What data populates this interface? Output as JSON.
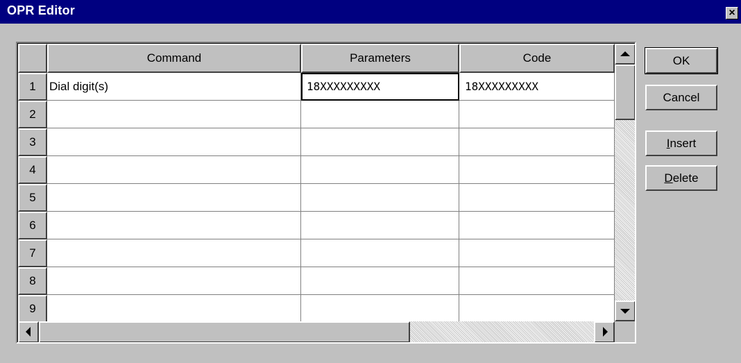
{
  "window": {
    "title": "OPR Editor",
    "close_glyph": "×"
  },
  "grid": {
    "columns": [
      "Command",
      "Parameters",
      "Code"
    ],
    "rows": [
      {
        "num": "1",
        "command": "Dial digit(s)",
        "parameters": "18XXXXXXXXX",
        "code": "18XXXXXXXXX"
      },
      {
        "num": "2",
        "command": "",
        "parameters": "",
        "code": ""
      },
      {
        "num": "3",
        "command": "",
        "parameters": "",
        "code": ""
      },
      {
        "num": "4",
        "command": "",
        "parameters": "",
        "code": ""
      },
      {
        "num": "5",
        "command": "",
        "parameters": "",
        "code": ""
      },
      {
        "num": "6",
        "command": "",
        "parameters": "",
        "code": ""
      },
      {
        "num": "7",
        "command": "",
        "parameters": "",
        "code": ""
      },
      {
        "num": "8",
        "command": "",
        "parameters": "",
        "code": ""
      },
      {
        "num": "9",
        "command": "",
        "parameters": "",
        "code": ""
      }
    ]
  },
  "buttons": {
    "ok": "OK",
    "cancel": "Cancel",
    "insert": "Insert",
    "delete": "Delete"
  },
  "colors": {
    "title_bar": "#000080",
    "face": "#c0c0c0",
    "cell": "#ffffff"
  },
  "icons": {
    "close": "close-icon",
    "scroll_up": "arrow-up-icon",
    "scroll_down": "arrow-down-icon",
    "scroll_left": "arrow-left-icon",
    "scroll_right": "arrow-right-icon"
  }
}
